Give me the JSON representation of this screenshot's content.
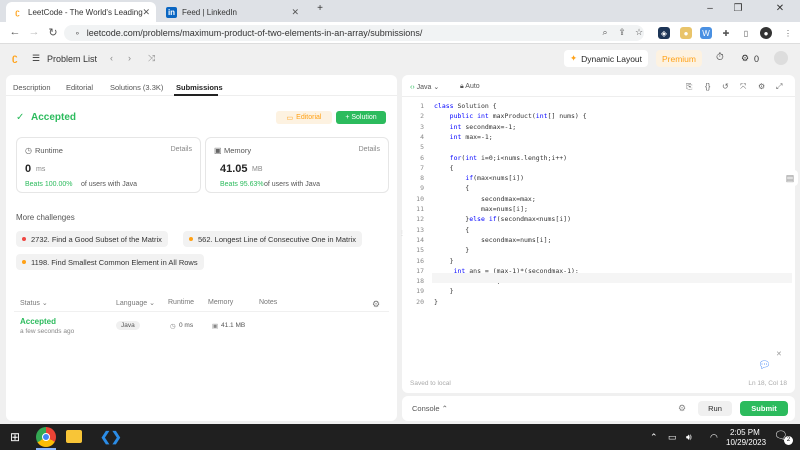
{
  "browser": {
    "tabs": [
      {
        "title": "LeetCode - The World's Leading",
        "active": true
      },
      {
        "title": "Feed | LinkedIn",
        "active": false
      }
    ],
    "url": "leetcode.com/problems/maximum-product-of-two-elements-in-an-array/submissions/"
  },
  "header": {
    "problem_list": "Problem List",
    "dynamic_layout": "Dynamic Layout",
    "premium": "Premium",
    "notif_count": "0"
  },
  "left": {
    "tabs": [
      "Description",
      "Editorial",
      "Solutions (3.3K)",
      "Submissions"
    ],
    "status": "Accepted",
    "editorial_btn": "Editorial",
    "solution_btn": "+ Solution",
    "runtime": {
      "label": "Runtime",
      "details": "Details",
      "value": "0",
      "unit": "ms",
      "beats": "Beats 100.00%",
      "beats_suffix": "of users with Java"
    },
    "memory": {
      "label": "Memory",
      "details": "Details",
      "value": "41.05",
      "unit": "MB",
      "beats": "Beats 95.63%",
      "beats_suffix": "of users with Java"
    },
    "more_challenges": "More challenges",
    "challenges": [
      {
        "text": "2732. Find a Good Subset of the Matrix",
        "color": "#ef4743"
      },
      {
        "text": "562. Longest Line of Consecutive One in Matrix",
        "color": "#ffa116"
      },
      {
        "text": "1198. Find Smallest Common Element in All Rows",
        "color": "#ffa116"
      }
    ],
    "table": {
      "headers": [
        "Status",
        "Language",
        "Runtime",
        "Memory",
        "Notes"
      ],
      "row": {
        "status": "Accepted",
        "time": "a few seconds ago",
        "language": "Java",
        "runtime": "0 ms",
        "memory": "41.1 MB"
      }
    }
  },
  "editor": {
    "language": "Java",
    "mode": "Auto",
    "lines": [
      "class Solution {",
      "    public int maxProduct(int[] nums) {",
      "    int secondmax=-1;",
      "    int max=-1;",
      "",
      "    for(int i=0;i<nums.length;i++)",
      "    {",
      "        if(max<nums[i])",
      "        {",
      "            secondmax=max;",
      "            max=nums[i];",
      "        }else if(secondmax<nums[i])",
      "        {",
      "            secondmax=nums[i];",
      "        }",
      "    }",
      "     int ans = (max-1)*(secondmax-1);",
      "      return ans;",
      "    }",
      "}"
    ],
    "saved": "Saved to local",
    "cursor": "Ln 18, Col 18"
  },
  "console": {
    "label": "Console",
    "run": "Run",
    "submit": "Submit"
  },
  "taskbar": {
    "time": "2:05 PM",
    "date": "10/29/2023",
    "notif": "2"
  },
  "colors": {
    "accepted": "#2cbb5d",
    "premium": "#ffa116",
    "blue_kw": "#0000ff"
  }
}
